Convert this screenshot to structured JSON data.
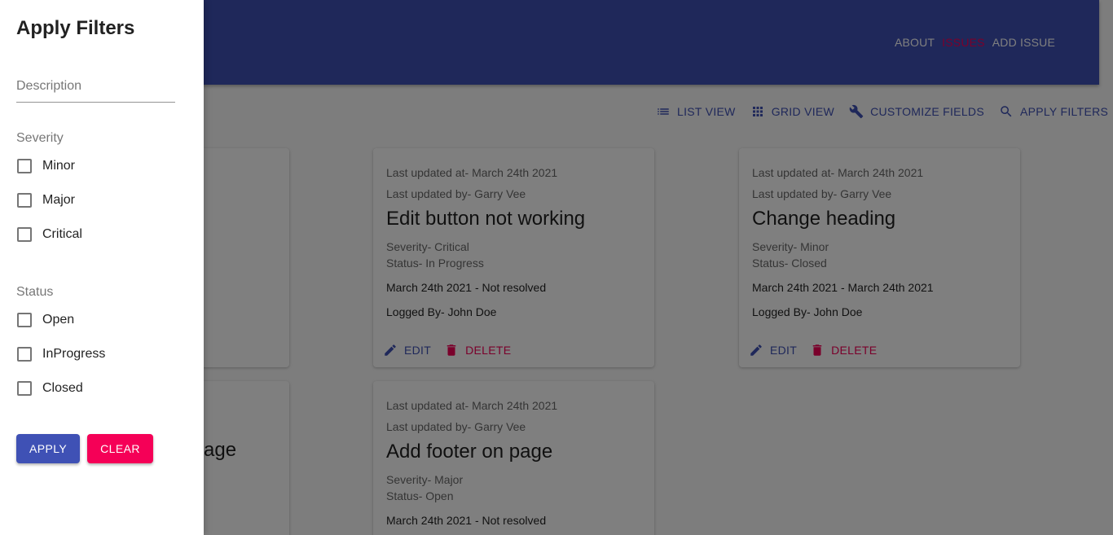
{
  "nav": {
    "about": "ABOUT",
    "issues": "ISSUES",
    "add_issue": "ADD ISSUE"
  },
  "toolbar": {
    "list_view": "LIST VIEW",
    "grid_view": "GRID VIEW",
    "customize_fields": "CUSTOMIZE FIELDS",
    "apply_filters": "APPLY FILTERS"
  },
  "cards": [
    {
      "updated_at": "Last updated at- March 24th 2021",
      "updated_by": "Last updated by- Garry Vee",
      "title": "Edit button not working",
      "severity": "Severity- Critical",
      "status": "Status- In Progress",
      "dates": "March 24th 2021 - Not resolved",
      "logged_by": "Logged By- John Doe",
      "edit": "EDIT",
      "delete": "DELETE"
    },
    {
      "updated_at": "Last updated at- March 24th 2021",
      "updated_by": "Last updated by- Garry Vee",
      "title": "Change heading",
      "severity": "Severity- Minor",
      "status": "Status- Closed",
      "dates": "March 24th 2021 - March 24th 2021",
      "logged_by": "Logged By- John Doe",
      "edit": "EDIT",
      "delete": "DELETE"
    },
    {
      "updated_at": "Last updated at- March 24th 2021",
      "updated_by": "Last updated by- Garry Vee",
      "title": "Add footer on page",
      "severity": "Severity- Major",
      "status": "Status- Open",
      "dates": "March 24th 2021 - Not resolved"
    }
  ],
  "partial_text": "age",
  "drawer": {
    "title": "Apply Filters",
    "description_placeholder": "Description",
    "severity_label": "Severity",
    "severity_options": [
      "Minor",
      "Major",
      "Critical"
    ],
    "status_label": "Status",
    "status_options": [
      "Open",
      "InProgress",
      "Closed"
    ],
    "apply": "APPLY",
    "clear": "CLEAR"
  },
  "colors": {
    "primary": "#3f51b5",
    "secondary": "#f50057"
  }
}
